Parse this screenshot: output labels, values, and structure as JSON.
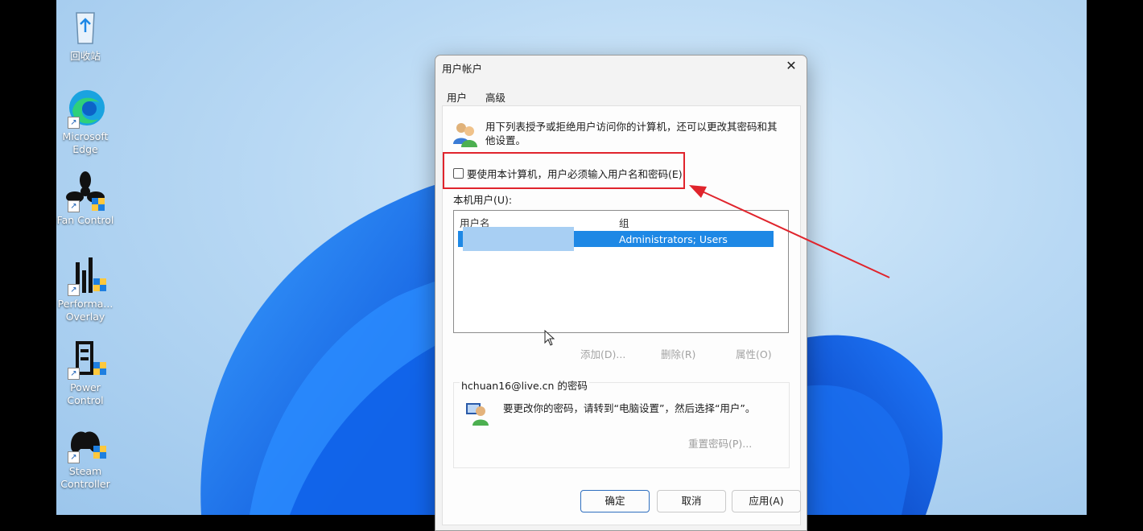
{
  "desktop": {
    "icons": [
      {
        "label": "回收站"
      },
      {
        "label": "Microsoft\nEdge"
      },
      {
        "label": "Fan Control"
      },
      {
        "label": "Performa...\nOverlay"
      },
      {
        "label": "Power\nControl"
      },
      {
        "label": "Steam\nController"
      }
    ]
  },
  "dialog": {
    "title": "用户帐户",
    "tabs": [
      {
        "label": "用户"
      },
      {
        "label": "高级"
      }
    ],
    "intro": "用下列表授予或拒绝用户访问你的计算机，还可以更改其密码和其他设置。",
    "checkbox_label": "要使用本计算机，用户必须输入用户名和密码(E)",
    "checkbox_checked": false,
    "local_users_label": "本机用户(U):",
    "table": {
      "headers": [
        "用户名",
        "组"
      ],
      "rows": [
        {
          "group": "Administrators; Users"
        }
      ]
    },
    "list_buttons": {
      "add": "添加(D)...",
      "remove": "删除(R)",
      "properties": "属性(O)"
    },
    "password_section": {
      "title": "hchuan16@live.cn 的密码",
      "text": "要更改你的密码，请转到“电脑设置”，然后选择“用户”。",
      "reset": "重置密码(P)..."
    },
    "buttons": {
      "ok": "确定",
      "cancel": "取消",
      "apply": "应用(A)"
    }
  },
  "colors": {
    "highlight_red": "#e0242c",
    "selection_blue": "#1e88e5"
  }
}
